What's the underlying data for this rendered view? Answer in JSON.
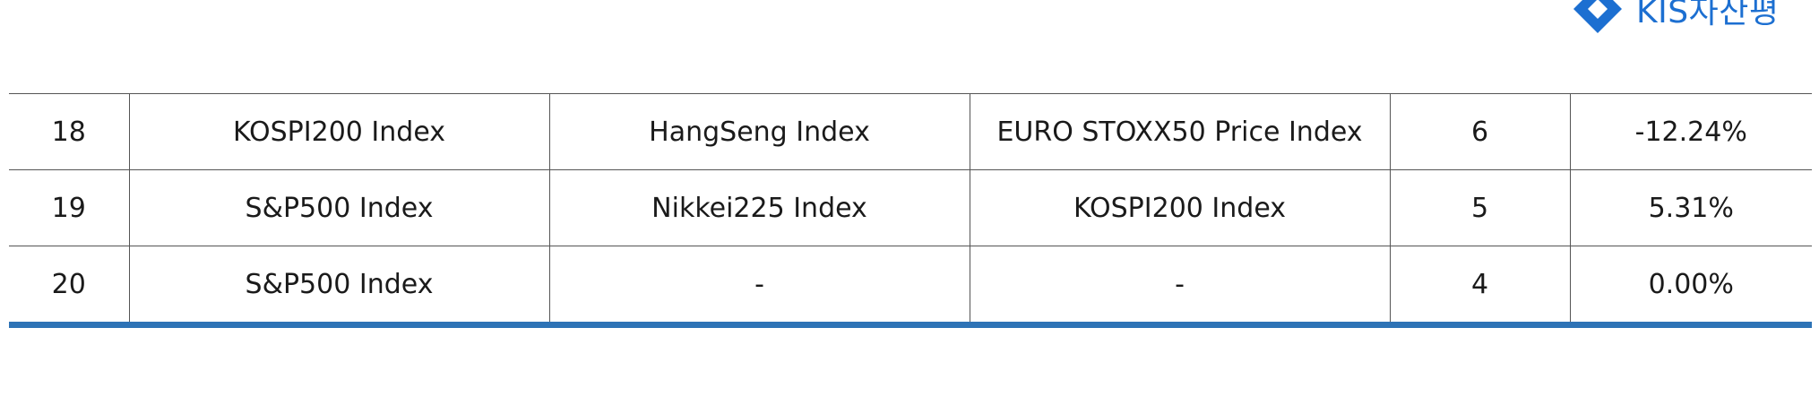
{
  "logo": {
    "text": "KIS자산평",
    "color": "#1C6FD1"
  },
  "table": {
    "rows": [
      [
        "18",
        "KOSPI200 Index",
        "HangSeng Index",
        "EURO STOXX50 Price Index",
        "6",
        "-12.24%"
      ],
      [
        "19",
        "S&P500 Index",
        "Nikkei225 Index",
        "KOSPI200 Index",
        "5",
        "5.31%"
      ],
      [
        "20",
        "S&P500 Index",
        "-",
        "-",
        "4",
        "0.00%"
      ]
    ]
  },
  "colors": {
    "bottom_rule": "#2E73B6",
    "grid": "#555555"
  }
}
